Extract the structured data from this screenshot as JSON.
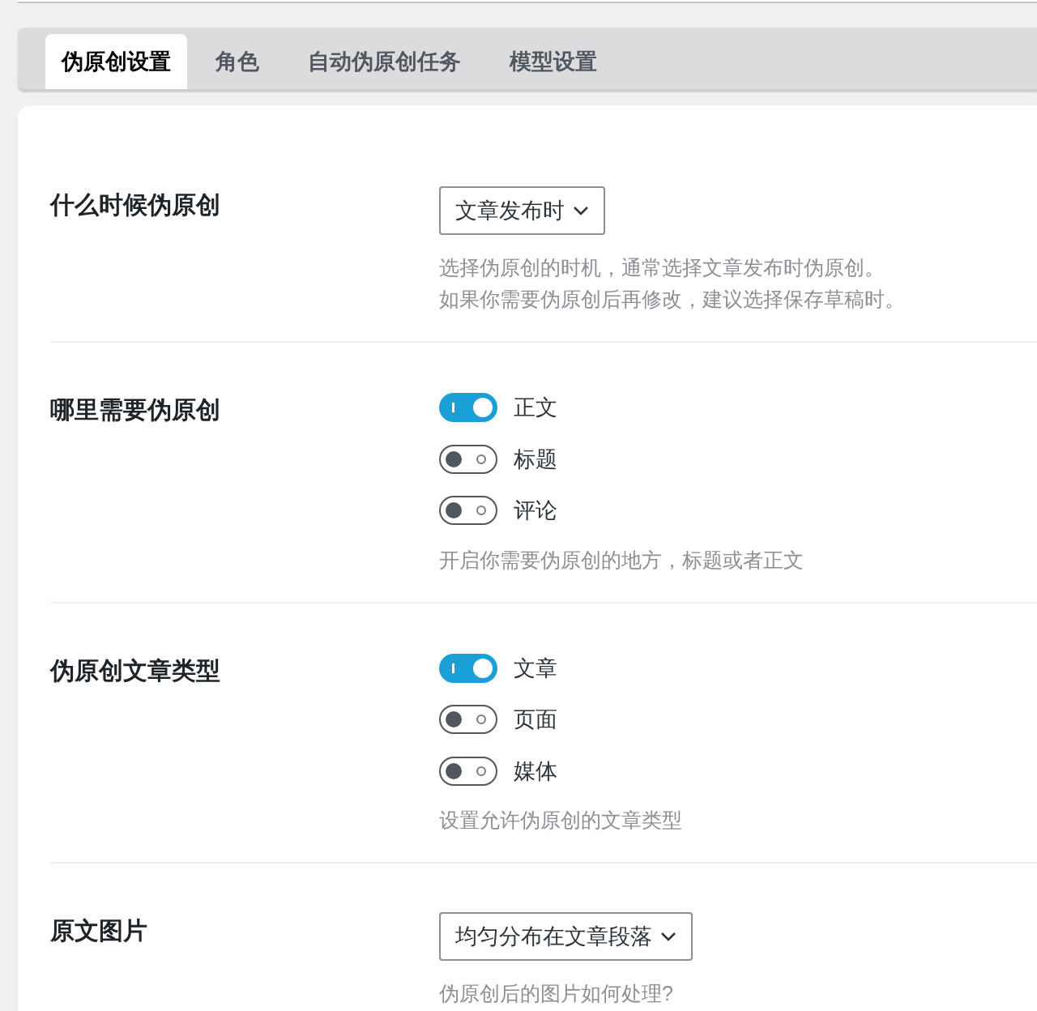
{
  "tabs": [
    {
      "label": "伪原创设置",
      "selected": true
    },
    {
      "label": "角色",
      "selected": false
    },
    {
      "label": "自动伪原创任务",
      "selected": false
    },
    {
      "label": "模型设置",
      "selected": false
    }
  ],
  "sections": [
    {
      "label": "什么时候伪原创",
      "kind": "select",
      "value": "文章发布时",
      "help": [
        "选择伪原创的时机，通常选择文章发布时伪原创。",
        "如果你需要伪原创后再修改，建议选择保存草稿时。"
      ]
    },
    {
      "label": "哪里需要伪原创",
      "kind": "toggles",
      "options": [
        {
          "label": "正文",
          "on": true
        },
        {
          "label": "标题",
          "on": false
        },
        {
          "label": "评论",
          "on": false
        }
      ],
      "help": [
        "开启你需要伪原创的地方，标题或者正文"
      ]
    },
    {
      "label": "伪原创文章类型",
      "kind": "toggles",
      "options": [
        {
          "label": "文章",
          "on": true
        },
        {
          "label": "页面",
          "on": false
        },
        {
          "label": "媒体",
          "on": false
        }
      ],
      "help": [
        "设置允许伪原创的文章类型"
      ]
    },
    {
      "label": "原文图片",
      "kind": "select",
      "value": "均匀分布在文章段落",
      "help": [
        "伪原创后的图片如何处理?"
      ]
    }
  ]
}
